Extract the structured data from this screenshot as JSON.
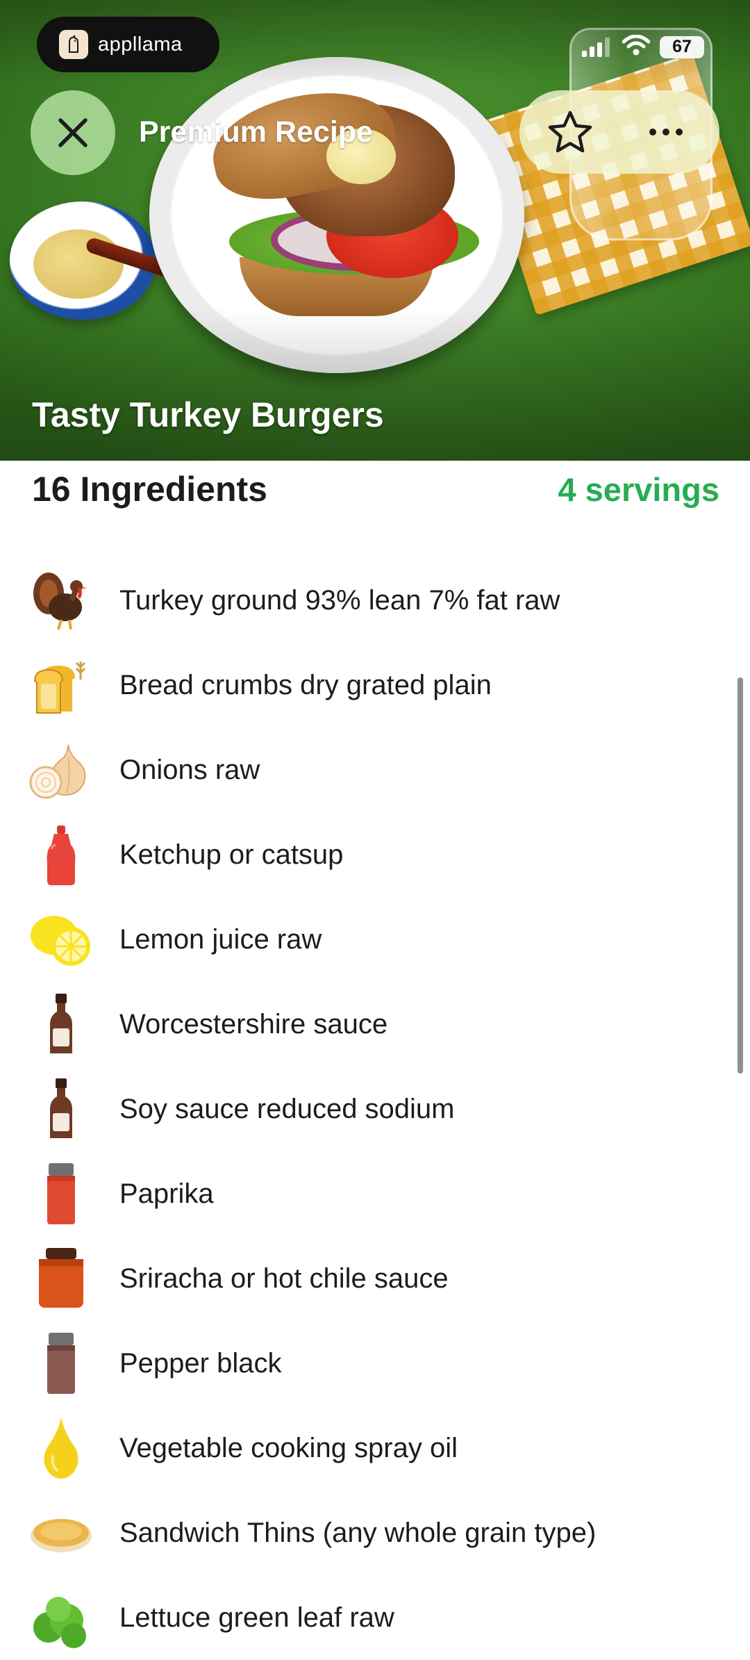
{
  "status_bar": {
    "app_name": "appllama",
    "battery": "67"
  },
  "nav": {
    "title": "Premium Recipe",
    "close_icon": "close-icon",
    "star_icon": "star-icon",
    "more_icon": "more-icon"
  },
  "recipe": {
    "title": "Tasty Turkey Burgers"
  },
  "ingredients": {
    "count_label": "16 Ingredients",
    "servings_label": "4 servings",
    "accent_color": "#25ad52",
    "items": [
      {
        "name": "Turkey ground 93% lean 7% fat raw",
        "icon": "turkey-icon"
      },
      {
        "name": "Bread crumbs dry grated plain",
        "icon": "bread-icon"
      },
      {
        "name": "Onions raw",
        "icon": "onion-icon"
      },
      {
        "name": "Ketchup or catsup",
        "icon": "ketchup-icon"
      },
      {
        "name": "Lemon juice raw",
        "icon": "lemon-icon"
      },
      {
        "name": "Worcestershire sauce",
        "icon": "sauce-bottle-icon"
      },
      {
        "name": "Soy sauce reduced sodium",
        "icon": "sauce-bottle-icon"
      },
      {
        "name": "Paprika",
        "icon": "paprika-jar-icon"
      },
      {
        "name": "Sriracha or hot chile sauce",
        "icon": "sriracha-jar-icon"
      },
      {
        "name": "Pepper black",
        "icon": "pepper-jar-icon"
      },
      {
        "name": "Vegetable cooking spray oil",
        "icon": "oil-drop-icon"
      },
      {
        "name": "Sandwich Thins (any whole grain type)",
        "icon": "sandwich-thin-icon"
      },
      {
        "name": "Lettuce green leaf raw",
        "icon": "lettuce-icon"
      }
    ]
  }
}
